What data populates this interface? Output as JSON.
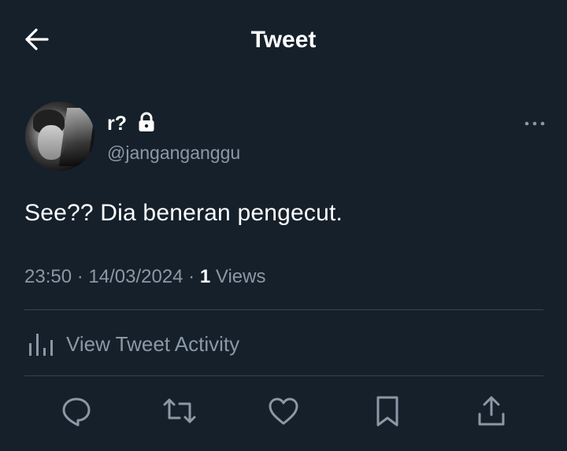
{
  "header": {
    "title": "Tweet",
    "back_icon": "arrow-left-icon"
  },
  "author": {
    "display_name": "r?",
    "handle": "@janganganggu",
    "protected_icon": "lock-icon"
  },
  "tweet": {
    "text": "See?? Dia beneran pengecut.",
    "time": "23:50",
    "separator": " · ",
    "date": "14/03/2024",
    "views_count": "1",
    "views_label": " Views"
  },
  "activity": {
    "label": "View Tweet Activity",
    "icon": "bar-chart-icon"
  },
  "actions": [
    {
      "name": "reply",
      "icon": "reply-icon"
    },
    {
      "name": "retweet",
      "icon": "retweet-icon"
    },
    {
      "name": "like",
      "icon": "heart-icon"
    },
    {
      "name": "bookmark",
      "icon": "bookmark-icon"
    },
    {
      "name": "share",
      "icon": "share-icon"
    }
  ],
  "colors": {
    "background": "#15202b",
    "text": "#ffffff",
    "muted": "#8b98a5",
    "divider": "#38444d"
  }
}
